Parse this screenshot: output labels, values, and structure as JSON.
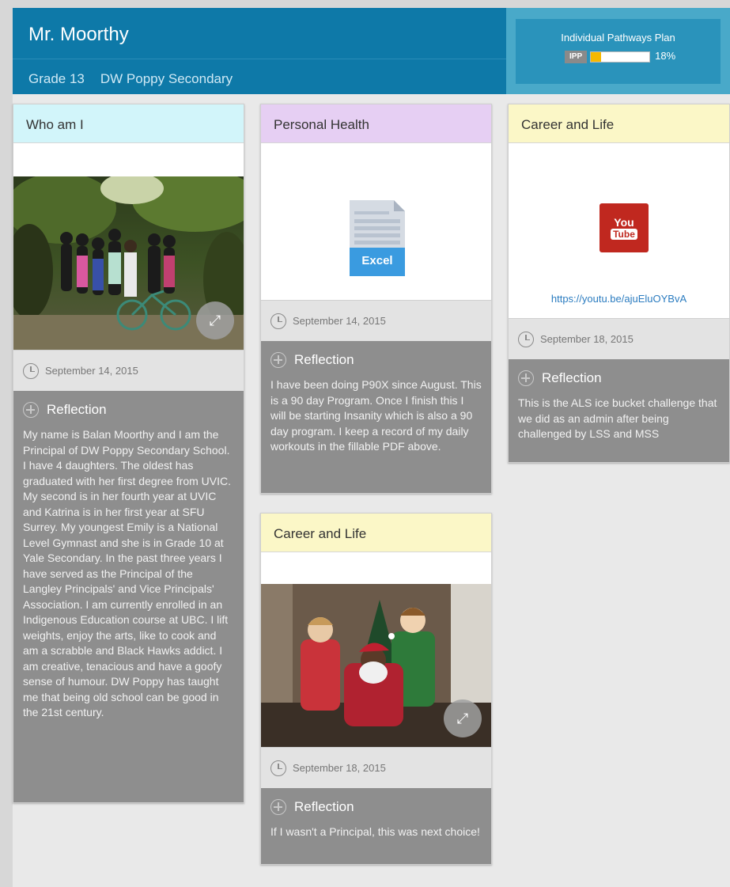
{
  "header": {
    "name": "Mr. Moorthy",
    "grade": "Grade 13",
    "school": "DW Poppy Secondary",
    "ipp_title": "Individual Pathways Plan",
    "ipp_badge": "IPP",
    "ipp_percent": "18%",
    "ipp_progress": 0.18
  },
  "cards": [
    {
      "title": "Who am I",
      "date": "September 14, 2015",
      "reflection_label": "Reflection",
      "reflection": "My name is Balan Moorthy and I am the Principal of DW Poppy Secondary School. I have 4 daughters. The oldest has graduated with her first degree from UVIC. My second is in her fourth year at UVIC and Katrina is in her first year at SFU Surrey. My youngest Emily is a National Level Gymnast and she is in Grade 10 at Yale Secondary. In the past three years I have served as the Principal of the Langley Principals' and Vice Principals' Association.  I am currently enrolled in an Indigenous Education course at UBC. I lift weights, enjoy the arts, like to cook and am a scrabble and Black Hawks addict. I am creative, tenacious and have a goofy sense of humour. DW Poppy has taught me that being old school can be good in the 21st century."
    },
    {
      "title": "Personal Health",
      "file_label": "Excel",
      "date": "September 14, 2015",
      "reflection_label": "Reflection",
      "reflection": "I have been doing P90X since August. This is a 90 day Program. Once I finish this I will be starting Insanity which is also a 90 day program.  I keep a record of my daily workouts in the fillable PDF above."
    },
    {
      "title": "Career and Life",
      "date": "September 18, 2015",
      "reflection_label": "Reflection",
      "reflection": "If I wasn't a Principal, this was next choice!"
    },
    {
      "title": "Career and Life",
      "youtube_top": "You",
      "youtube_bottom": "Tube",
      "link": "https://youtu.be/ajuEluOYBvA",
      "date": "September 18, 2015",
      "reflection_label": "Reflection",
      "reflection": "This is the ALS ice bucket challenge that we did as an admin after being challenged by LSS and MSS"
    }
  ],
  "colors": {
    "header_dark": "#0e79a8",
    "header_light": "#49a9c9",
    "head_who": "#d2f5fa",
    "head_health": "#e6cff3",
    "head_career": "#fbf7c7",
    "reflection_bg": "#8e8e8e"
  }
}
